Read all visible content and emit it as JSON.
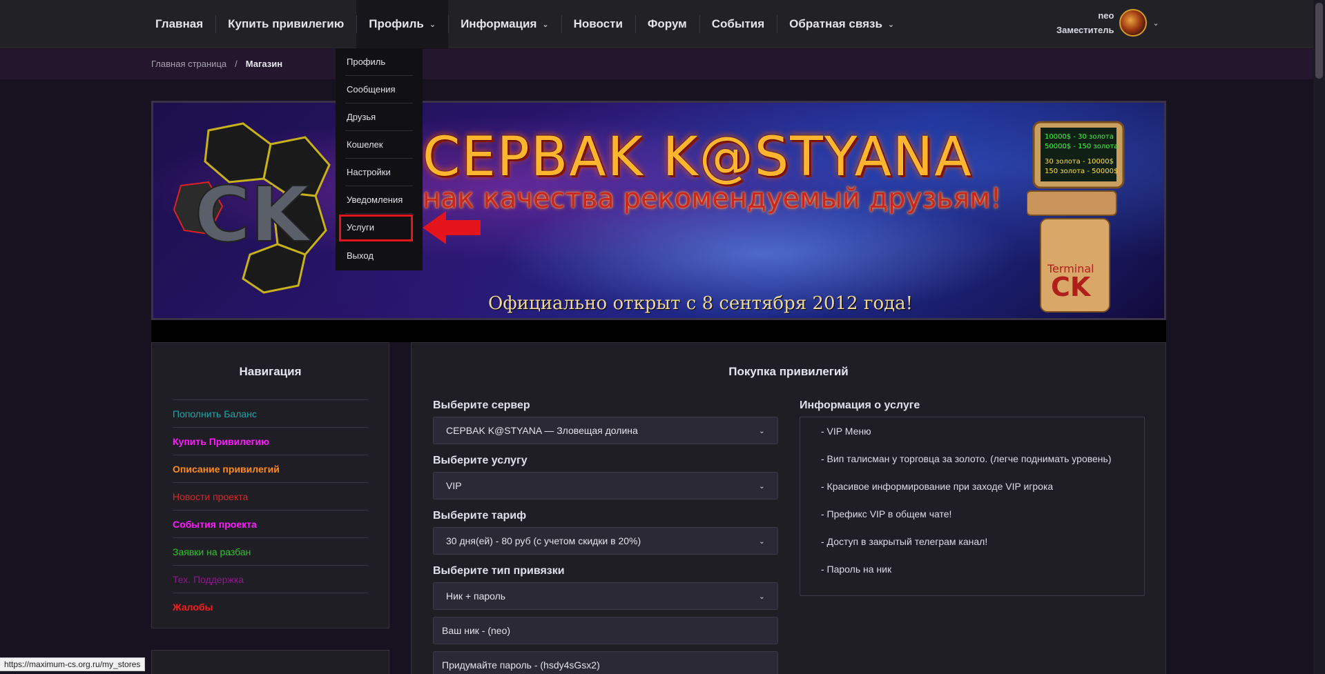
{
  "nav": {
    "items": [
      {
        "label": "Главная",
        "has_dropdown": false
      },
      {
        "label": "Купить привилегию",
        "has_dropdown": false
      },
      {
        "label": "Профиль",
        "has_dropdown": true
      },
      {
        "label": "Информация",
        "has_dropdown": true
      },
      {
        "label": "Новости",
        "has_dropdown": false
      },
      {
        "label": "Форум",
        "has_dropdown": false
      },
      {
        "label": "События",
        "has_dropdown": false
      },
      {
        "label": "Обратная связь",
        "has_dropdown": true
      }
    ],
    "chevron": "⌄"
  },
  "user": {
    "name": "neo",
    "role": "Заместитель"
  },
  "breadcrumb": {
    "home": "Главная страница",
    "separator": "/",
    "current": "Магазин"
  },
  "banner": {
    "title": "CEPBAK K@STYANA",
    "subtitle": "нак качества рекомендуемый друзьям!",
    "footer": "Официально открыт с 8 сентября 2012 года!",
    "logo_text": "CK",
    "terminal_lines": [
      "10000$ - 30 золота",
      "50000$ - 150 золота",
      "30 золота - 10000$",
      "150 золота - 50000$"
    ],
    "terminal_label": "Terminal",
    "terminal_logo": "CK"
  },
  "profile_dropdown": {
    "items": [
      "Профиль",
      "Сообщения",
      "Друзья",
      "Кошелек",
      "Настройки",
      "Уведомления",
      "Услуги",
      "Выход"
    ],
    "highlighted": "Услуги"
  },
  "sidebar": {
    "title": "Навигация",
    "items": [
      {
        "label": "Пополнить Баланс",
        "color": "#1aa7a7"
      },
      {
        "label": "Купить Привилегию",
        "color": "#ff1aff"
      },
      {
        "label": "Описание привилегий",
        "color": "#ff8c1a"
      },
      {
        "label": "Новости проекта",
        "color": "#d42a2a"
      },
      {
        "label": "События проекта",
        "color": "#ff1aff"
      },
      {
        "label": "Заявки на разбан",
        "color": "#2ec42e"
      },
      {
        "label": "Тех. Поддержка",
        "color": "#8c1a8c"
      },
      {
        "label": "Жалобы",
        "color": "#ff1a1a"
      }
    ]
  },
  "shop": {
    "title": "Покупка привилегий",
    "server_label": "Выберите сервер",
    "server_value": "CEPBAK K@STYANA — Зловещая долина",
    "service_label": "Выберите услугу",
    "service_value": "VIP",
    "tariff_label": "Выберите тариф",
    "tariff_value": "30 дня(ей) - 80 руб (с учетом скидки в 20%)",
    "binding_label": "Выберите тип привязки",
    "binding_value": "Ник + пароль",
    "nick_placeholder": "Ваш ник - (neo)",
    "password_placeholder": "Придумайте пароль - (hsdy4sGsx2)",
    "info_label": "Информация о услуге",
    "info_items": [
      "- VIP Меню",
      "- Вип талисман у торговца за золото. (легче поднимать уровень)",
      "- Красивое информирование при заходе VIP игрока",
      "- Префикс VIP в общем чате!",
      "- Доступ в закрытый телеграм канал!",
      "- Пароль на ник"
    ]
  },
  "status_url": "https://maximum-cs.org.ru/my_stores",
  "colors": {
    "highlight": "#e3141b",
    "arrow": "#e3141b",
    "page_bg": "#17121f"
  }
}
